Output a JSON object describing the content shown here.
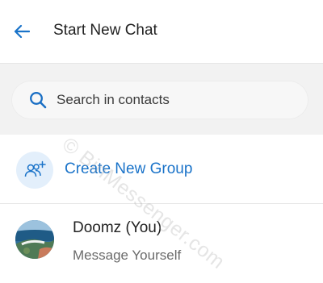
{
  "header": {
    "back_icon": "arrow-left-icon",
    "title": "Start New Chat"
  },
  "search": {
    "placeholder": "Search in contacts",
    "value": "",
    "icon": "search-icon"
  },
  "create_group": {
    "icon": "add-group-icon",
    "label": "Create New Group"
  },
  "contacts": [
    {
      "name": "Doomz (You)",
      "subtitle": "Message Yourself",
      "avatar": "coastal-photo-avatar"
    }
  ],
  "watermark": "© BinMessenger.com",
  "colors": {
    "accent": "#1a73c9",
    "background": "#ffffff",
    "search_band": "#f2f2f2",
    "group_icon_bg": "#e3effb",
    "divider": "#e6e6e6"
  }
}
